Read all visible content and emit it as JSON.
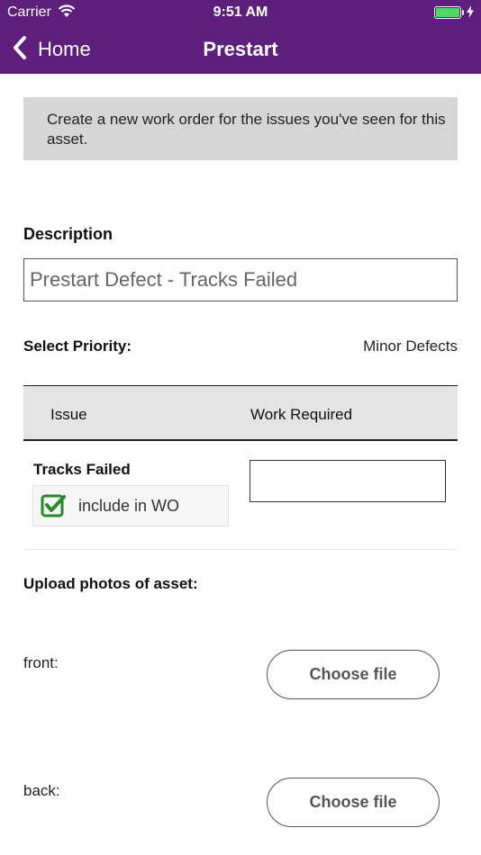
{
  "status_bar": {
    "carrier": "Carrier",
    "time": "9:51 AM"
  },
  "nav": {
    "back_label": "Home",
    "title": "Prestart"
  },
  "info": {
    "text": "Create a new work order for the issues you've seen for this asset."
  },
  "description": {
    "label": "Description",
    "value": "Prestart Defect - Tracks Failed"
  },
  "priority": {
    "label": "Select Priority:",
    "value": "Minor Defects"
  },
  "table": {
    "headers": [
      "Issue",
      "Work Required"
    ],
    "rows": [
      {
        "issue": "Tracks Failed",
        "include_label": "include in WO",
        "include_checked": true,
        "work_required": ""
      }
    ]
  },
  "photos": {
    "label": "Upload photos of asset:",
    "items": [
      {
        "label": "front:",
        "button": "Choose file"
      },
      {
        "label": "back:",
        "button": "Choose file"
      }
    ]
  },
  "colors": {
    "header_bg": "#5e1f7c",
    "check_green": "#2a8a2a"
  },
  "icons": [
    "wifi-icon",
    "battery-icon",
    "charging-bolt-icon",
    "chevron-left-icon",
    "checkbox-checked-icon"
  ]
}
